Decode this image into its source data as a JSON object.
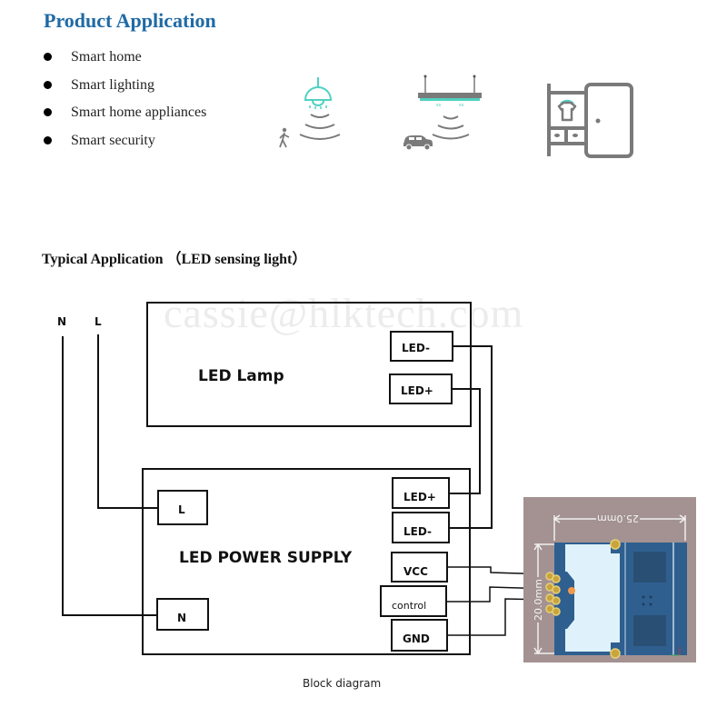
{
  "header": {
    "title": "Product Application"
  },
  "applications": [
    {
      "label": "Smart home"
    },
    {
      "label": "Smart lighting"
    },
    {
      "label": "Smart home appliances"
    },
    {
      "label": "Smart security"
    }
  ],
  "icons": [
    {
      "name": "pendant-lamp-person-sensing-icon"
    },
    {
      "name": "ceiling-light-car-sensing-icon"
    },
    {
      "name": "wardrobe-icon"
    }
  ],
  "colors": {
    "title_blue": "#1f6aa5",
    "accent_cyan": "#4fd1c1",
    "icon_gray": "#7a7a7a",
    "pcb_blue": "#2f5f8f",
    "pcb_board": "#a09090"
  },
  "typical": {
    "title": "Typical Application （LED sensing light）"
  },
  "watermark": "cassie@hlktech.com",
  "diagram": {
    "mains_labels": {
      "n": "N",
      "l": "L"
    },
    "lamp": {
      "label": "LED Lamp",
      "terminals": [
        "LED-",
        "LED+"
      ]
    },
    "power_supply": {
      "label": "LED POWER SUPPLY",
      "input_terminals": [
        "L",
        "N"
      ],
      "output_terminals": [
        "LED+",
        "LED-",
        "VCC",
        "control",
        "GND"
      ]
    },
    "module": {
      "width_label": "25.0mm",
      "height_label": "20.0mm"
    },
    "caption": "Block diagram"
  }
}
